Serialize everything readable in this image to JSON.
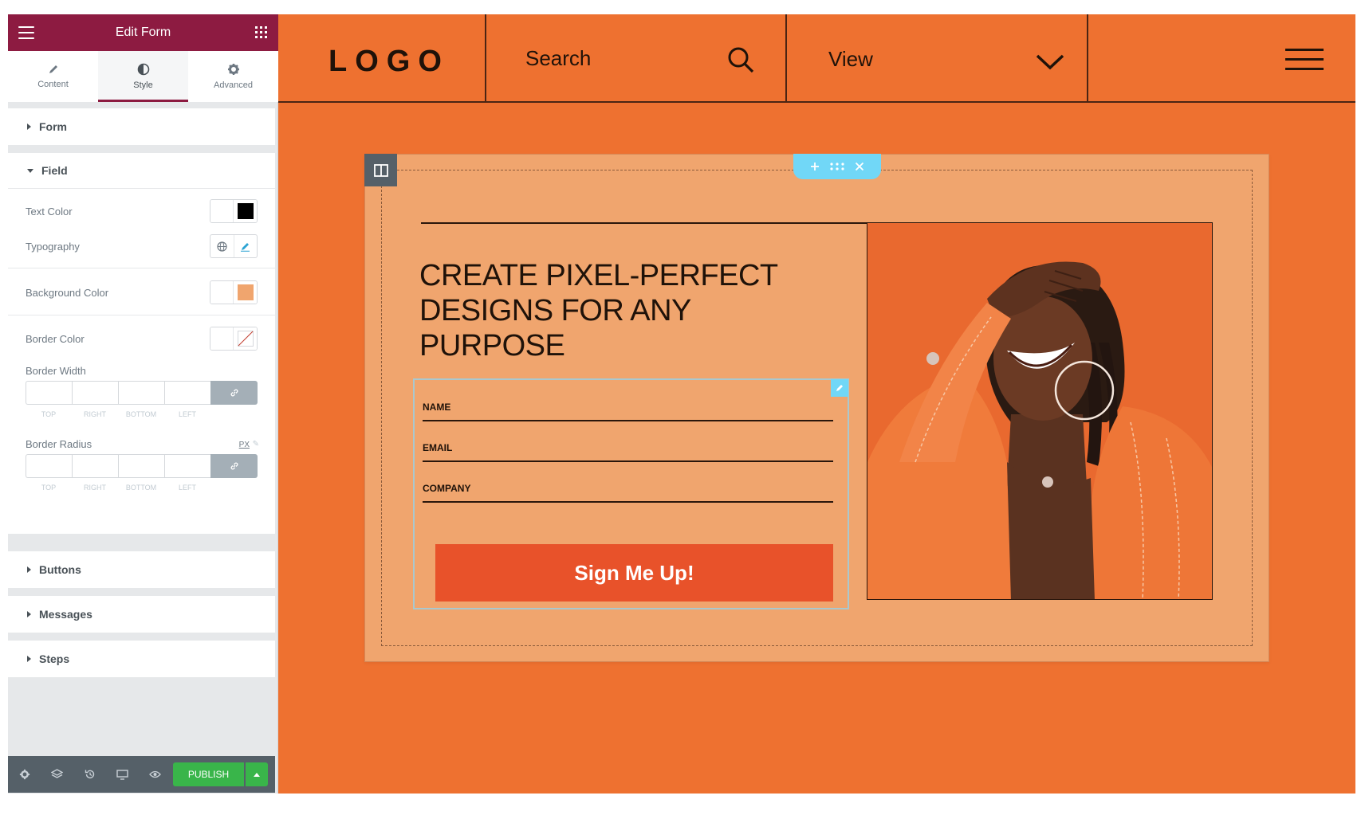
{
  "panel": {
    "title": "Edit Form",
    "tabs": [
      {
        "label": "Content",
        "icon": "pencil-icon"
      },
      {
        "label": "Style",
        "icon": "half-circle-icon"
      },
      {
        "label": "Advanced",
        "icon": "gear-icon"
      }
    ],
    "active_tab": "Style",
    "sections": {
      "form": "Form",
      "field": "Field",
      "buttons": "Buttons",
      "messages": "Messages",
      "steps": "Steps"
    },
    "field_controls": {
      "text_color": {
        "label": "Text Color",
        "value": "#000000"
      },
      "typography": {
        "label": "Typography"
      },
      "background_color": {
        "label": "Background Color",
        "value": "#f0a56e"
      },
      "border_color": {
        "label": "Border Color",
        "value": "none"
      },
      "border_width": {
        "label": "Border Width"
      },
      "border_radius": {
        "label": "Border Radius",
        "unit": "PX"
      },
      "dimension_labels": [
        "TOP",
        "RIGHT",
        "BOTTOM",
        "LEFT"
      ]
    },
    "publish_label": "PUBLISH",
    "accent_color": "#8d1b41",
    "publish_color": "#39b54a"
  },
  "site": {
    "logo": "LOGO",
    "search": "Search",
    "view": "View",
    "background": "#ee7130",
    "headline": "CREATE PIXEL-PERFECT DESIGNS FOR ANY PURPOSE",
    "form_fields": [
      "NAME",
      "EMAIL",
      "COMPANY"
    ],
    "submit_label": "Sign Me Up!",
    "submit_color": "#e8522a"
  }
}
